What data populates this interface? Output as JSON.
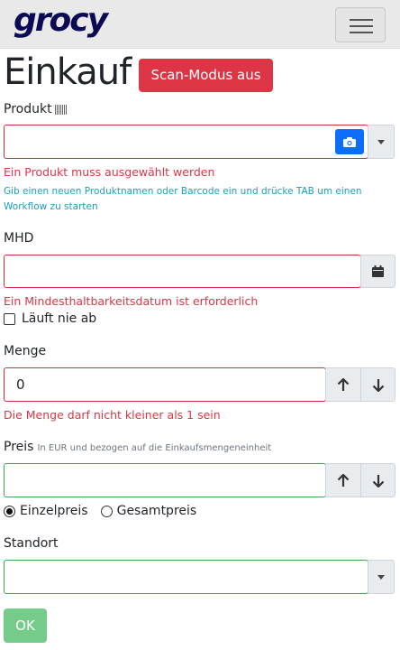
{
  "navbar": {
    "logo": "grocy"
  },
  "page": {
    "title": "Einkauf",
    "scan_button": "Scan-Modus aus"
  },
  "product": {
    "label": "Produkt",
    "value": "",
    "error": "Ein Produkt muss ausgewählt werden",
    "hint": "Gib einen neuen Produktnamen oder Barcode ein und drücke TAB um einen Workflow zu starten"
  },
  "mhd": {
    "label": "MHD",
    "value": "",
    "error": "Ein Mindesthaltbarkeitsdatum ist erforderlich",
    "never_expires_label": "Läuft nie ab"
  },
  "amount": {
    "label": "Menge",
    "value": "0",
    "error": "Die Menge darf nicht kleiner als 1 sein"
  },
  "price": {
    "label": "Preis",
    "sublabel": "In EUR und bezogen auf die Einkaufsmengeneinheit",
    "value": "",
    "option_unit": "Einzelpreis",
    "option_total": "Gesamtpreis"
  },
  "location": {
    "label": "Standort",
    "value": ""
  },
  "submit": {
    "label": "OK"
  },
  "colors": {
    "danger": "#dc3545",
    "success": "#28a745",
    "primary": "#0d6efd",
    "info": "#17a2b8"
  }
}
